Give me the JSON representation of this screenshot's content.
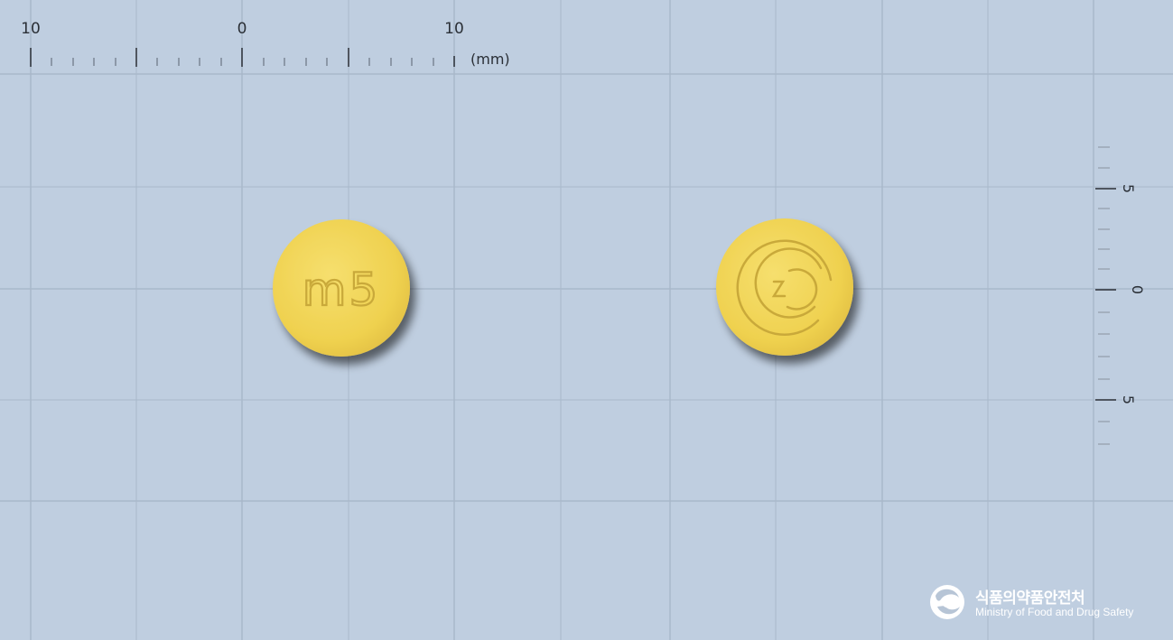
{
  "top_ruler": {
    "labels": [
      "10",
      "0",
      "10"
    ],
    "unit": "(mm)"
  },
  "side_ruler": {
    "labels": [
      "5",
      "0",
      "5"
    ]
  },
  "pills": [
    {
      "view": "front",
      "imprint": "m5",
      "color": "#f1d55a"
    },
    {
      "view": "back",
      "imprint": "D-logo",
      "color": "#f1d55a"
    }
  ],
  "logo": {
    "name_korean": "식품의약품안전처",
    "name_english": "Ministry of Food and Drug Safety"
  },
  "colors": {
    "background": "#bfcee0",
    "grid": "#a7b6c8",
    "pill_yellow": "#f1d55a"
  }
}
